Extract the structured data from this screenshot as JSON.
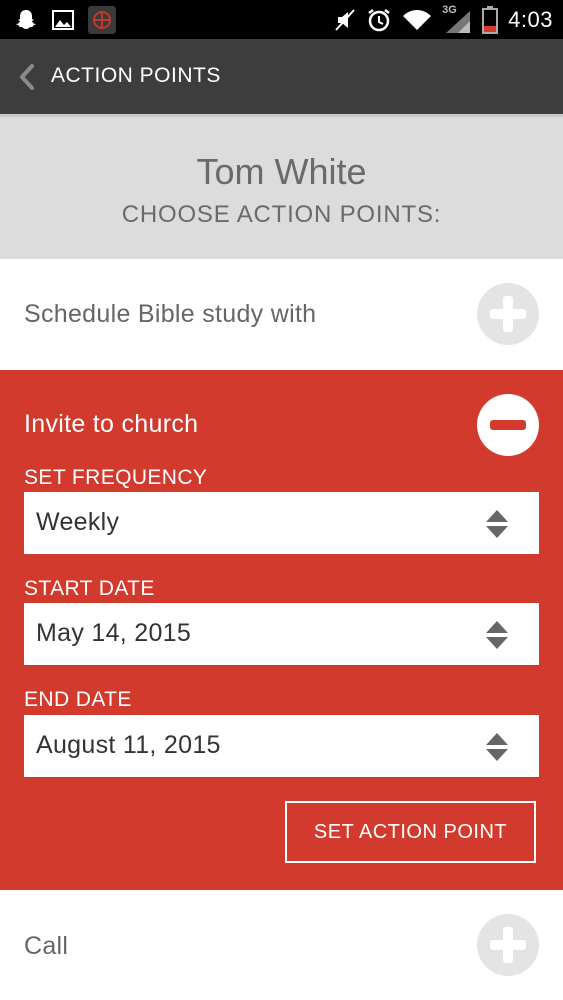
{
  "status_bar": {
    "time": "4:03",
    "network_type": "3G",
    "left_icons": [
      "snapchat-ghost-icon",
      "image-icon",
      "app-notification-icon"
    ],
    "right_icons": [
      "mute-icon",
      "alarm-icon",
      "wifi-icon",
      "signal-icon",
      "battery-icon"
    ],
    "battery_color": "#d13a2c"
  },
  "app_bar": {
    "back_icon": "chevron-left-icon",
    "title": "ACTION POINTS"
  },
  "header": {
    "name": "Tom White",
    "subtitle": "CHOOSE ACTION POINTS:"
  },
  "action_points": [
    {
      "label": "Schedule Bible study with",
      "expanded": false,
      "toggle_icon": "plus-circle-icon"
    },
    {
      "label": "Invite to church",
      "expanded": true,
      "toggle_icon": "minus-circle-icon"
    },
    {
      "label": "Call",
      "expanded": false,
      "toggle_icon": "plus-circle-icon"
    }
  ],
  "form": {
    "frequency": {
      "label": "SET FREQUENCY",
      "value": "Weekly"
    },
    "start_date": {
      "label": "START DATE",
      "value": "May 14, 2015"
    },
    "end_date": {
      "label": "END DATE",
      "value": "August 11, 2015"
    },
    "submit_label": "SET ACTION POINT"
  },
  "colors": {
    "accent_red": "#d13a2c",
    "app_bar": "#3d3d3d",
    "header_bg": "#dcdcdc",
    "text_gray": "#666666"
  }
}
